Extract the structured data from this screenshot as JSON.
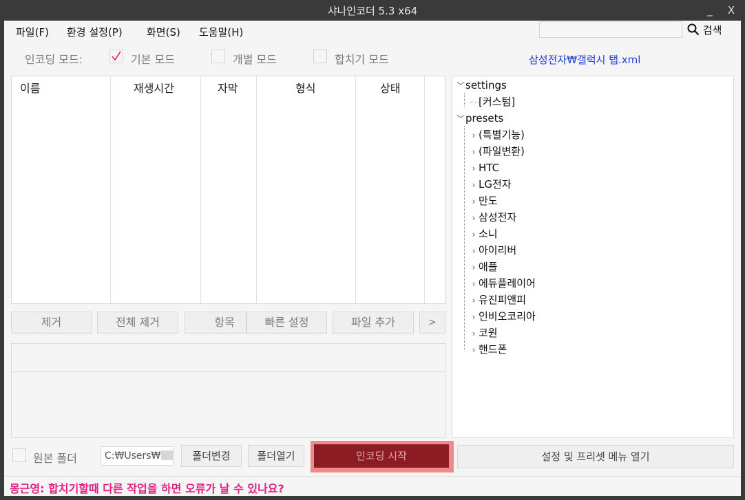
{
  "window": {
    "title": "샤나인코더  5.3  x64",
    "minimize": "_",
    "close": "X"
  },
  "menu": {
    "items": [
      "파일(F)",
      "환경 설정(P)",
      "화면(S)",
      "도움말(H)"
    ],
    "search_value": "",
    "search_label": "검색"
  },
  "modes": {
    "label": "인코딩 모드:",
    "options": [
      {
        "label": "기본 모드",
        "checked": true
      },
      {
        "label": "개별 모드",
        "checked": false
      },
      {
        "label": "합치기 모드",
        "checked": false
      }
    ],
    "preset_path": "삼성전자₩갤럭시 탭.xml"
  },
  "file_table": {
    "columns": [
      "이름",
      "재생시간",
      "자막",
      "형식",
      "상태"
    ],
    "rows": []
  },
  "buttons": {
    "remove": "제거",
    "remove_all": "전체 제거",
    "items": "항목",
    "quick_settings": "빠른 설정",
    "add_file": "파일 추가",
    "more": ">",
    "source_folder": "원본 폴더",
    "change_folder": "폴더변경",
    "open_folder": "폴더열기",
    "start_encoding": "인코딩 시작",
    "settings_presets": "설정 및 프리셋 메뉴 열기"
  },
  "output_path": "C:₩Users₩",
  "tree": {
    "settings": {
      "label": "settings",
      "children": [
        "[커스텀]"
      ]
    },
    "presets": {
      "label": "presets",
      "children": [
        "(특별기능)",
        "(파일변환)",
        "HTC",
        "LG전자",
        "만도",
        "삼성전자",
        "소니",
        "아이리버",
        "애플",
        "에듀플레이어",
        "유진피앤피",
        "인비오코리아",
        "코원",
        "핸드폰"
      ]
    }
  },
  "status": {
    "message": "몽근영: 합치기할때 다른 작업을 하면 오류가 날 수 있나요?",
    "color": "#e0207d"
  },
  "colors": {
    "start_button": "#8b1c24",
    "start_highlight": "#f08a8a",
    "link": "#1e3fd6"
  }
}
